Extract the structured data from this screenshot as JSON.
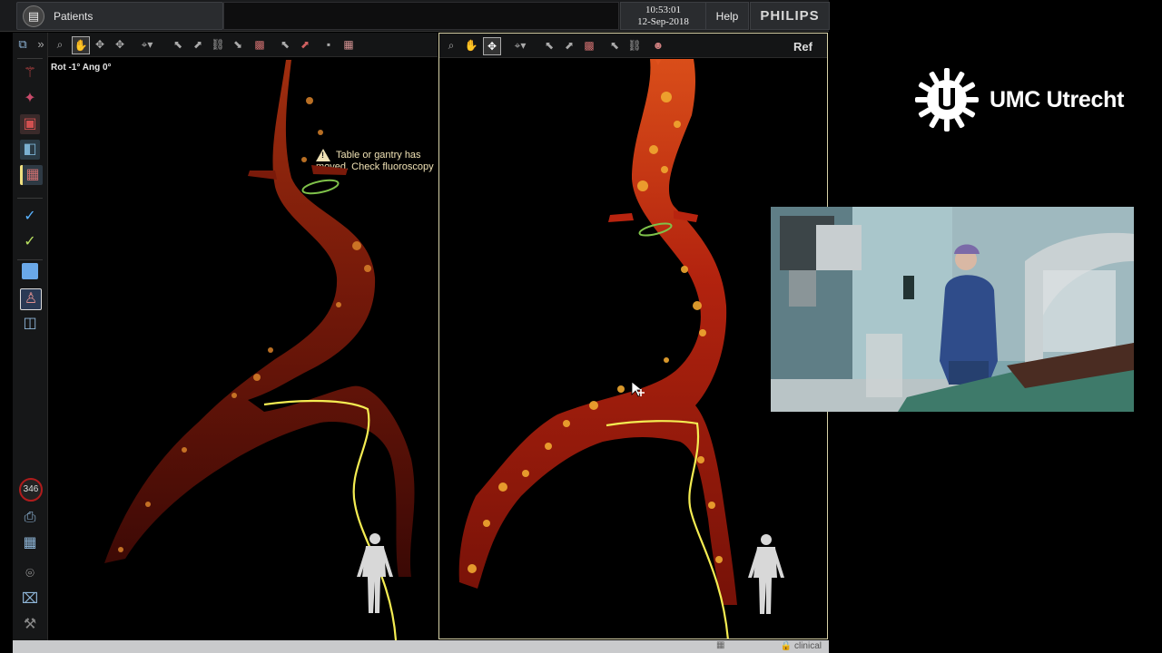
{
  "header": {
    "patients_label": "Patients",
    "time": "10:53:01",
    "date": "12-Sep-2018",
    "help_label": "Help",
    "brand": "PHILIPS"
  },
  "viewport_left": {
    "rotation_label": "Rot -1° Ang  0°",
    "warning": "Table or gantry has moved. Check fluoroscopy"
  },
  "viewport_right": {
    "ref_label": "Ref"
  },
  "sidebar": {
    "counter": "346"
  },
  "statusbar": {
    "mode": "clinical"
  },
  "overlay": {
    "logo_text": "UMC Utrecht"
  },
  "colors": {
    "vessel_dark": "#5a0c07",
    "vessel_bright": "#c4230e",
    "calcification": "#f0a830",
    "guidewire": "#f4ec52",
    "ring": "#7fc24a",
    "viewport_border": "#d8d2a8"
  }
}
